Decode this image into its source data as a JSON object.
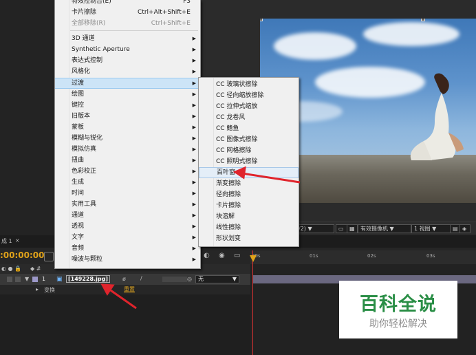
{
  "effect_menu": {
    "items": [
      {
        "label": "特效控制台(E)",
        "shortcut": "F3",
        "disabled": false,
        "submenu": false
      },
      {
        "label": "卡片擦除",
        "shortcut": "Ctrl+Alt+Shift+E",
        "disabled": false,
        "submenu": false
      },
      {
        "label": "全部移除(R)",
        "shortcut": "Ctrl+Shift+E",
        "disabled": true,
        "submenu": false
      },
      {
        "label": "3D 通道",
        "submenu": true
      },
      {
        "label": "Synthetic Aperture",
        "submenu": true
      },
      {
        "label": "表达式控制",
        "submenu": true
      },
      {
        "label": "风格化",
        "submenu": true
      },
      {
        "label": "过渡",
        "submenu": true,
        "highlighted": true
      },
      {
        "label": "绘图",
        "submenu": true
      },
      {
        "label": "键控",
        "submenu": true
      },
      {
        "label": "旧版本",
        "submenu": true
      },
      {
        "label": "蒙板",
        "submenu": true
      },
      {
        "label": "模糊与锐化",
        "submenu": true
      },
      {
        "label": "模拟仿真",
        "submenu": true
      },
      {
        "label": "扭曲",
        "submenu": true
      },
      {
        "label": "色彩校正",
        "submenu": true
      },
      {
        "label": "生成",
        "submenu": true
      },
      {
        "label": "时间",
        "submenu": true
      },
      {
        "label": "实用工具",
        "submenu": true
      },
      {
        "label": "通道",
        "submenu": true
      },
      {
        "label": "透视",
        "submenu": true
      },
      {
        "label": "文字",
        "submenu": true
      },
      {
        "label": "音频",
        "submenu": true
      },
      {
        "label": "噪波与颗粒",
        "submenu": true
      }
    ]
  },
  "transition_submenu": {
    "items": [
      {
        "label": "CC 玻璃状擦除"
      },
      {
        "label": "CC 径向缩放擦除"
      },
      {
        "label": "CC 拉伸式缩放"
      },
      {
        "label": "CC 龙卷风"
      },
      {
        "label": "CC 鳍鱼"
      },
      {
        "label": "CC 图像式擦除"
      },
      {
        "label": "CC 网格擦除"
      },
      {
        "label": "CC 照明式擦除"
      },
      {
        "label": "百叶窗",
        "highlighted": true
      },
      {
        "label": "渐变擦除"
      },
      {
        "label": "径向擦除"
      },
      {
        "label": "卡片擦除"
      },
      {
        "label": "块溶解"
      },
      {
        "label": "线性擦除"
      },
      {
        "label": "形状划变"
      }
    ]
  },
  "viewer_toolbar": {
    "resolution": "/2)",
    "camera": "有效摄像机",
    "view": "1 视图"
  },
  "timeline": {
    "tab": "成 1",
    "timecode": ":00:00:00",
    "ruler_ticks": [
      "00s",
      "01s",
      "02s",
      "03s"
    ],
    "layer": {
      "index": "1",
      "name": "[149228.jpg]",
      "parent": "无"
    },
    "sub_item": "变换",
    "reset": "重置"
  },
  "watermark": {
    "title": "百科全说",
    "subtitle": "助你轻松解决"
  },
  "colors": {
    "accent_timecode": "#e0a21a",
    "menu_highlight": "#cce4f7",
    "arrow": "#e0242c",
    "watermark_green": "#2a8e46"
  }
}
